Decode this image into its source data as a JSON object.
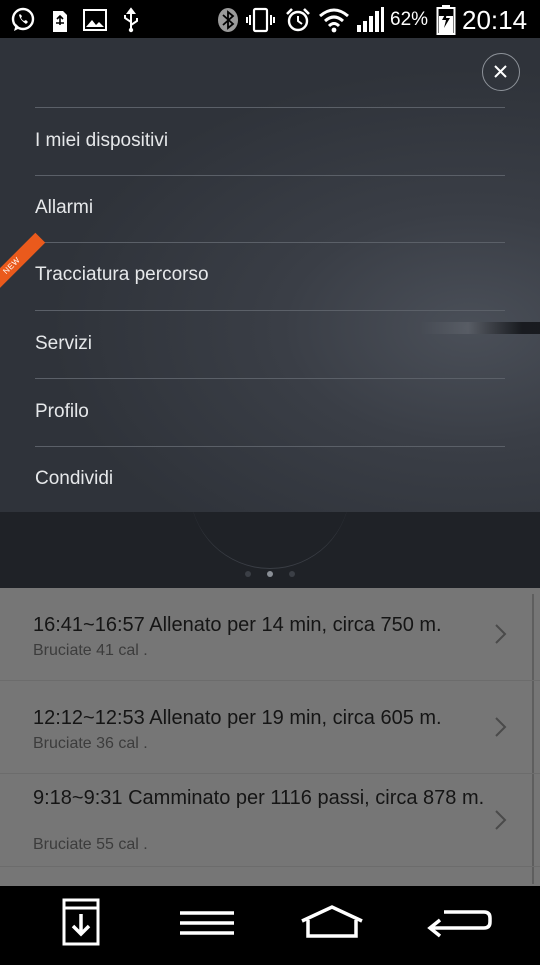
{
  "status_bar": {
    "icons": [
      "whatsapp-icon",
      "usb-storage-icon",
      "image-icon",
      "usb-icon",
      "bluetooth-icon",
      "vibrate-icon",
      "alarm-icon",
      "wifi-icon",
      "signal-icon",
      "battery-charging-icon"
    ],
    "battery_percent": "62%",
    "time": "20:14"
  },
  "menu": {
    "new_badge": "NEW",
    "items": [
      {
        "label": "I miei dispositivi"
      },
      {
        "label": "Allarmi"
      },
      {
        "label": "Tracciatura percorso",
        "badge": "NEW"
      },
      {
        "label": "Servizi"
      },
      {
        "label": "Profilo"
      },
      {
        "label": "Condividi"
      }
    ]
  },
  "pager": {
    "pages": 3,
    "active": 2
  },
  "activities": [
    {
      "title": "16:41~16:57  Allenato per 14 min, circa 750 m.",
      "calories": "Bruciate 41 cal ."
    },
    {
      "title": "12:12~12:53  Allenato per 19 min, circa 605 m.",
      "calories": "Bruciate 36 cal ."
    },
    {
      "title": "9:18~9:31  Camminato per 1116 passi, circa 878 m.",
      "calories": "Bruciate 55 cal ."
    }
  ],
  "nav_bar": {
    "buttons": [
      "notification-download-icon",
      "menu-icon",
      "home-icon",
      "back-icon"
    ]
  },
  "colors": {
    "menu_background": "#3a3e46",
    "menu_text": "#e6e8ea",
    "new_badge": "#ea5a1c",
    "list_background": "#767676"
  }
}
